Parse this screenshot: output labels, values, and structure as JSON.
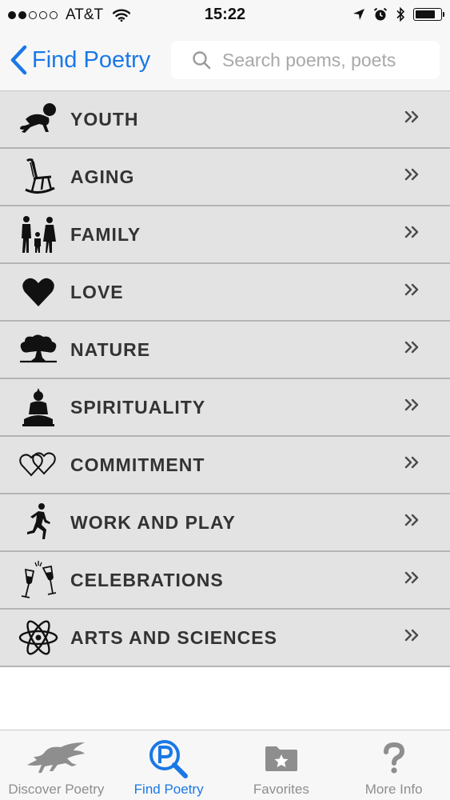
{
  "status_bar": {
    "carrier": "AT&T",
    "time": "15:22"
  },
  "nav": {
    "back_label": "Find Poetry",
    "search_placeholder": "Search poems, poets"
  },
  "categories": [
    {
      "label": "YOUTH",
      "icon": "crawling-baby-icon"
    },
    {
      "label": "AGING",
      "icon": "rocking-chair-icon"
    },
    {
      "label": "FAMILY",
      "icon": "family-icon"
    },
    {
      "label": "LOVE",
      "icon": "heart-icon"
    },
    {
      "label": "NATURE",
      "icon": "tree-icon"
    },
    {
      "label": "SPIRITUALITY",
      "icon": "buddha-icon"
    },
    {
      "label": "COMMITMENT",
      "icon": "linked-hearts-icon"
    },
    {
      "label": "WORK AND PLAY",
      "icon": "runner-icon"
    },
    {
      "label": "CELEBRATIONS",
      "icon": "champagne-glasses-icon"
    },
    {
      "label": "ARTS AND SCIENCES",
      "icon": "atom-icon"
    }
  ],
  "tabs": [
    {
      "label": "Discover Poetry",
      "icon": "pegasus-icon",
      "active": false
    },
    {
      "label": "Find Poetry",
      "icon": "search-p-icon",
      "active": true
    },
    {
      "label": "Favorites",
      "icon": "star-folder-icon",
      "active": false
    },
    {
      "label": "More Info",
      "icon": "question-mark-icon",
      "active": false
    }
  ],
  "colors": {
    "accent": "#1a78e6",
    "row_background": "#e3e3e3",
    "row_text": "#333333",
    "tab_inactive": "#8e8e8e"
  }
}
